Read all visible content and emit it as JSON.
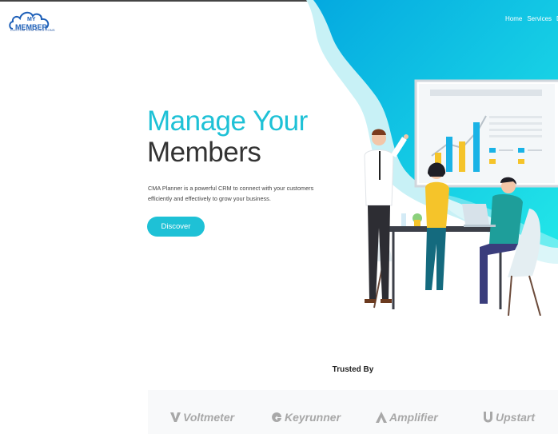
{
  "brand": {
    "logo_top": "MY",
    "logo_main": "MEMBER",
    "logo_sub": "CUSTOM CRM SOLUTIONS",
    "icon": "cloud-icon"
  },
  "nav": {
    "items": [
      "Home",
      "Services",
      "De"
    ]
  },
  "hero": {
    "headline_line1": "Manage Your",
    "headline_line2": "Members",
    "description": "CMA Planner is a powerful CRM to connect with your customers efficiently and effectively to grow your business.",
    "cta_label": "Discover"
  },
  "trusted": {
    "heading": "Trusted By",
    "logos": [
      "Voltmeter",
      "Keyrunner",
      "Amplifier",
      "Upstart"
    ]
  },
  "colors": {
    "accent": "#1ec1d6",
    "gradient_start": "#00b4e0",
    "gradient_end": "#1de2e8",
    "text_dark": "#333333"
  }
}
